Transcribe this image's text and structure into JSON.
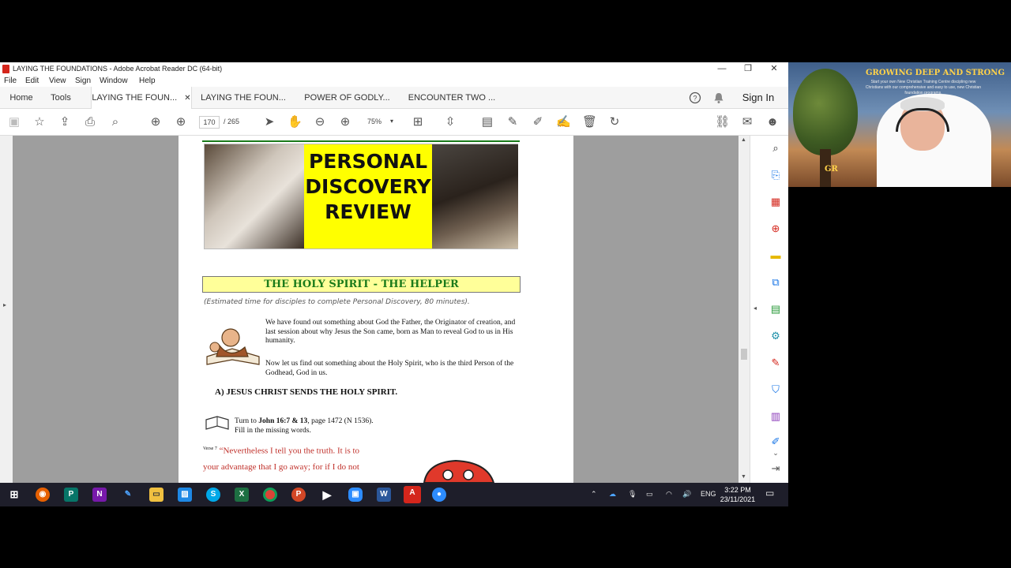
{
  "window": {
    "title": "LAYING THE FOUNDATIONS - Adobe Acrobat Reader DC (64-bit)",
    "minimize": "—",
    "restore": "❐",
    "close": "✕"
  },
  "menu": [
    "File",
    "Edit",
    "View",
    "Sign",
    "Window",
    "Help"
  ],
  "tabs": {
    "home": "Home",
    "tools": "Tools",
    "docs": [
      "LAYING THE FOUN...",
      "LAYING THE FOUN...",
      "POWER OF GODLY...",
      "ENCOUNTER TWO ..."
    ],
    "close_glyph": "✕",
    "sign_in": "Sign In"
  },
  "toolbar": {
    "page_current": "170",
    "page_total": "/ 265",
    "zoom": "75%"
  },
  "document": {
    "banner_text": [
      "PERSONAL",
      "DISCOVERY",
      "REVIEW"
    ],
    "heading": "THE HOLY SPIRIT - THE HELPER",
    "estimate": "(Estimated time for disciples to complete Personal Discovery, 80 minutes).",
    "para1": "We have found out something about God the Father, the Originator of creation, and last session about why Jesus the Son came, born as Man to reveal God to us in His humanity.",
    "para2": "Now let us find out something about the Holy Spirit, who is the third Person of the Godhead, God in us.",
    "section_a": "A) JESUS CHRIST SENDS THE HOLY SPIRIT.",
    "turn_to_prefix": "Turn to ",
    "turn_to_ref": "John 16:7 & 13",
    "turn_to_suffix": ", page 1472 (N 1536).",
    "fill_in": "Fill in the missing words.",
    "verse_label": "Verse 7",
    "verse_line1": "“Nevertheless I tell you the truth. It is to",
    "verse_line2": "your advantage that I go away; for if I do not"
  },
  "taskbar": {
    "lang": "ENG",
    "time": "3:22 PM",
    "date": "23/11/2021"
  },
  "webcam": {
    "title": "GROWING DEEP AND STRONG",
    "subtitle": "Start your own New Christian Training Centre discipling new Christians with our comprehensive and easy to use, new Christian foundation programs.",
    "corner_text": "GR"
  },
  "colors": {
    "heading_green": "#1b7b1b",
    "heading_bg": "#ffff99",
    "banner_yellow": "#ffff00",
    "verse_red": "#c0302a",
    "acrobat_red": "#d4261c"
  }
}
